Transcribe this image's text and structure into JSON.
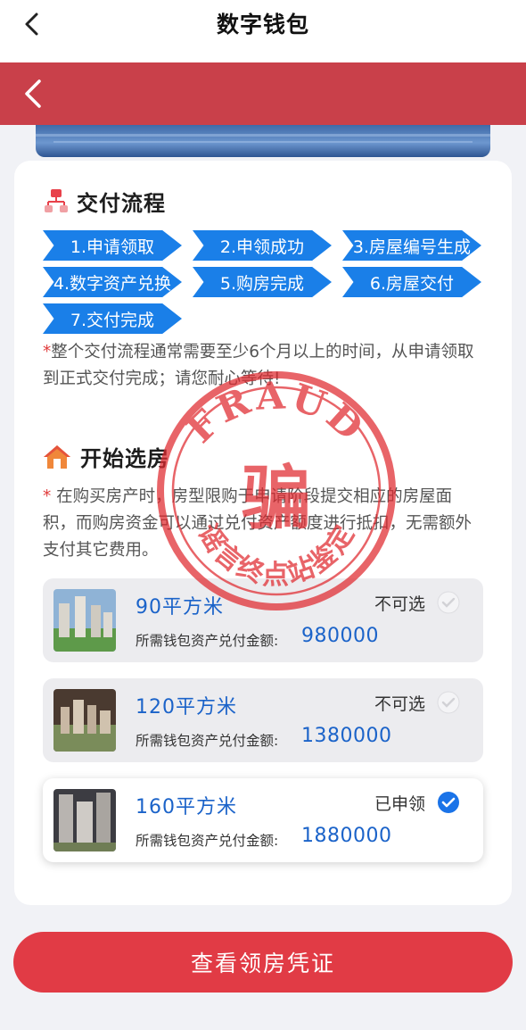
{
  "header": {
    "title": "数字钱包"
  },
  "delivery": {
    "title": "交付流程",
    "steps": [
      "1.申请领取",
      "2.申领成功",
      "3.房屋编号生成",
      "4.数字资产兑换",
      "5.购房完成",
      "6.房屋交付",
      "7.交付完成"
    ],
    "note_star": "*",
    "note": "整个交付流程通常需要至少6个月以上的时间，从申请领取到正式交付完成；请您耐心等待!"
  },
  "selection": {
    "title": "开始选房",
    "note_star": "*",
    "note": " 在购买房产时，房型限购于申请阶段提交相应的房屋面积，而购房资金可以通过兑付资产额度进行抵扣，无需额外支付其它费用。",
    "options": [
      {
        "area": "90平方米",
        "status": "不可选",
        "price_label": "所需钱包资产兑付金额:",
        "price": "980000"
      },
      {
        "area": "120平方米",
        "status": "不可选",
        "price_label": "所需钱包资产兑付金额:",
        "price": "1380000"
      },
      {
        "area": "160平方米",
        "status": "已申领",
        "price_label": "所需钱包资产兑付金额:",
        "price": "1880000"
      }
    ]
  },
  "cta": {
    "label": "查看领房凭证"
  },
  "watermark": {
    "top": "FRAUD",
    "center": "骗",
    "bottom": "谣言终点站鉴定"
  },
  "colors": {
    "accent": "#1a7fe8",
    "brand_red": "#e13b45",
    "stamp_red": "#e0292f"
  }
}
